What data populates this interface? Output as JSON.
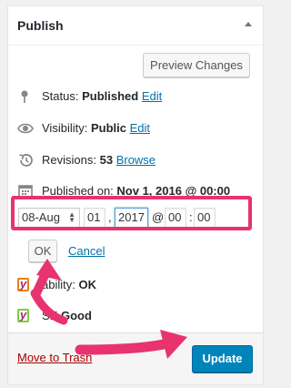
{
  "panel": {
    "title": "Publish",
    "preview_label": "Preview Changes"
  },
  "status": {
    "label": "Status:",
    "value": "Published",
    "edit": "Edit"
  },
  "visibility": {
    "label": "Visibility:",
    "value": "Public",
    "edit": "Edit"
  },
  "revisions": {
    "label": "Revisions:",
    "value": "53",
    "browse": "Browse"
  },
  "published": {
    "label": "Published on:",
    "value": "Nov 1, 2016 @ 00:00"
  },
  "date_editor": {
    "month": "08-Aug",
    "day": "01",
    "sep_comma": ",",
    "year": "2017",
    "at": "@",
    "hour": "00",
    "sep_colon": ":",
    "minute": "00",
    "ok_label": "OK",
    "cancel_label": "Cancel"
  },
  "readability": {
    "label": "Readability:",
    "visible_label": "ability:",
    "value": "OK"
  },
  "seo": {
    "label": "SEO:",
    "visible_label": "SE",
    "value": "Good"
  },
  "footer": {
    "trash_label": "Move to Trash",
    "update_label": "Update"
  },
  "colors": {
    "highlight": "#e8336e",
    "primary_button": "#0085ba",
    "link": "#0073aa",
    "trash": "#aa0000",
    "yoast_orange": "#ee7c1b",
    "yoast_green": "#7ad03a"
  }
}
